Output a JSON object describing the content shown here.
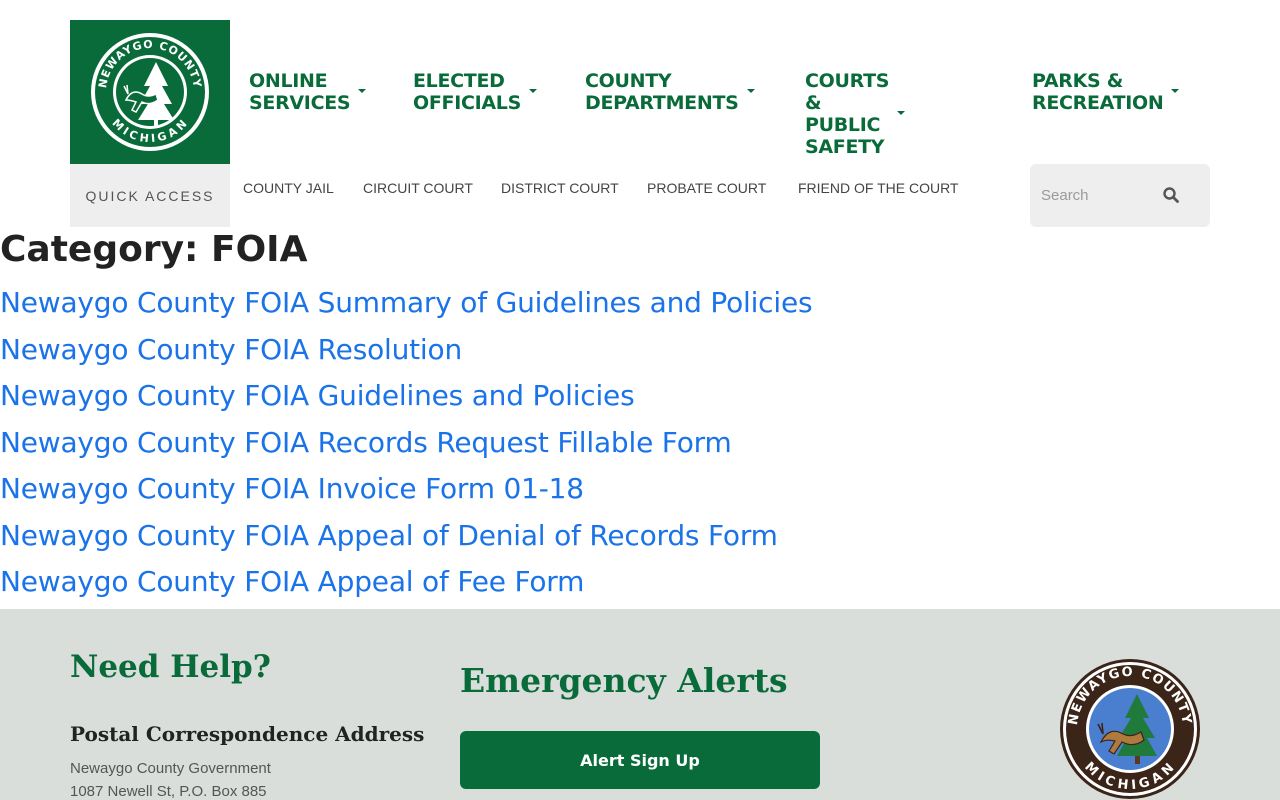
{
  "header": {
    "logo": {
      "top_text": "NEWAYGO COUNTY",
      "bottom_text": "MICHIGAN",
      "icon": "county-seal-deer-tree-icon"
    },
    "nav": [
      {
        "label": "ONLINE\nSERVICES"
      },
      {
        "label": "ELECTED\nOFFICIALS"
      },
      {
        "label": "COUNTY\nDEPARTMENTS"
      },
      {
        "label": "COURTS &\nPUBLIC SAFETY"
      },
      {
        "label": "PARKS &\nRECREATION"
      }
    ],
    "quick_access_label": "QUICK ACCESS",
    "quick_links": [
      "COUNTY JAIL",
      "CIRCUIT COURT",
      "DISTRICT COURT",
      "PROBATE COURT",
      "FRIEND OF THE COURT"
    ],
    "search": {
      "placeholder": "Search",
      "value": "",
      "icon": "search-icon"
    }
  },
  "main": {
    "title": "Category: FOIA",
    "links": [
      "Newaygo County FOIA Summary of Guidelines and Policies",
      "Newaygo County FOIA Resolution",
      "Newaygo County FOIA Guidelines and Policies",
      "Newaygo County FOIA Records Request Fillable Form",
      "Newaygo County FOIA Invoice Form 01-18",
      "Newaygo County FOIA Appeal of Denial of Records Form",
      "Newaygo County FOIA Appeal of Fee Form"
    ]
  },
  "footer": {
    "need_help": "Need Help?",
    "postal_title": "Postal Correspondence Address",
    "address": [
      "Newaygo County Government",
      "1087 Newell St, P.O. Box 885"
    ],
    "alerts_title": "Emergency Alerts",
    "alert_button": "Alert Sign Up",
    "seal": {
      "top_text": "NEWAYGO COUNTY",
      "bottom_text": "MICHIGAN"
    }
  },
  "colors": {
    "brand_green": "#0a6b3a",
    "link_blue": "#1a73e8",
    "footer_bg": "#d9dedb",
    "seal_blue": "#4a7fd0",
    "seal_brown": "#3b2418"
  }
}
